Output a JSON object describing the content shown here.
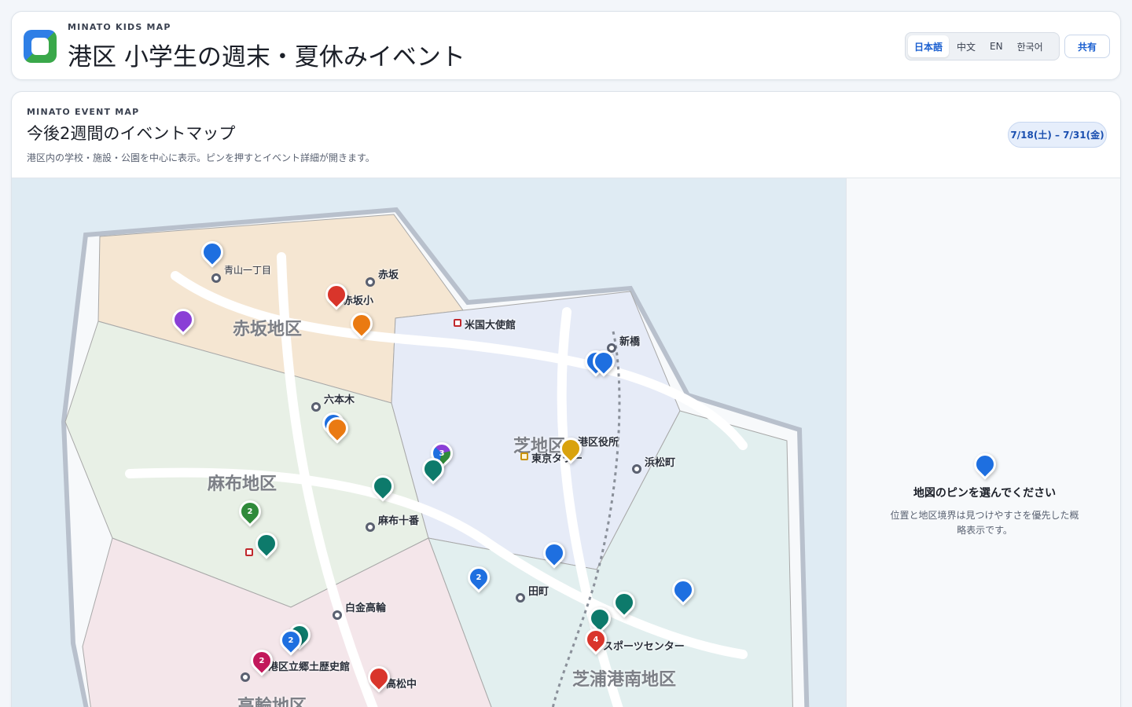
{
  "header": {
    "eyebrow": "MINATO KIDS MAP",
    "title": "港区 小学生の週末・夏休みイベント",
    "languages": [
      "日本語",
      "中文",
      "EN",
      "한국어"
    ],
    "active_language": "日本語",
    "share_label": "共有"
  },
  "panel": {
    "eyebrow": "MINATO EVENT MAP",
    "title": "今後2週間のイベントマップ",
    "subtitle": "港区内の学校・施設・公園を中心に表示。ピンを押すとイベント詳細が開きます。",
    "date_range": "7/18(土) – 7/31(金)"
  },
  "sidebar": {
    "title": "地図のピンを選んでください",
    "description": "位置と地区境界は見つけやすさを優先した概略表示です。"
  },
  "map": {
    "districts": [
      {
        "name": "赤坂地区",
        "color": "#f5e6d2"
      },
      {
        "name": "麻布地区",
        "color": "#e8f0e6"
      },
      {
        "name": "芝地区",
        "color": "#e6ebf7"
      },
      {
        "name": "芝浦港南地区",
        "color": "#e2efef"
      },
      {
        "name": "高輪地区",
        "color": "#f4e6ea"
      }
    ],
    "stations": [
      "青山一丁目",
      "赤坂",
      "六本木",
      "新橋",
      "浜松町",
      "麻布十番",
      "田町",
      "白金高輪"
    ],
    "places": [
      "赤坂小",
      "米国大使館",
      "港区役所",
      "東京タワー",
      "スポーツセンター",
      "港区立郷土歴史館",
      "高松中"
    ],
    "pin_colors": {
      "blue": "#1e6fe0",
      "red": "#d9352b",
      "orange": "#ea7a12",
      "purple": "#8a3fd6",
      "teal": "#0d7a6b",
      "green": "#2f8a3a",
      "gold": "#d9a20e",
      "magenta": "#c2185b"
    },
    "cluster_counts": [
      "3",
      "2",
      "2",
      "4",
      "2",
      "2"
    ]
  }
}
